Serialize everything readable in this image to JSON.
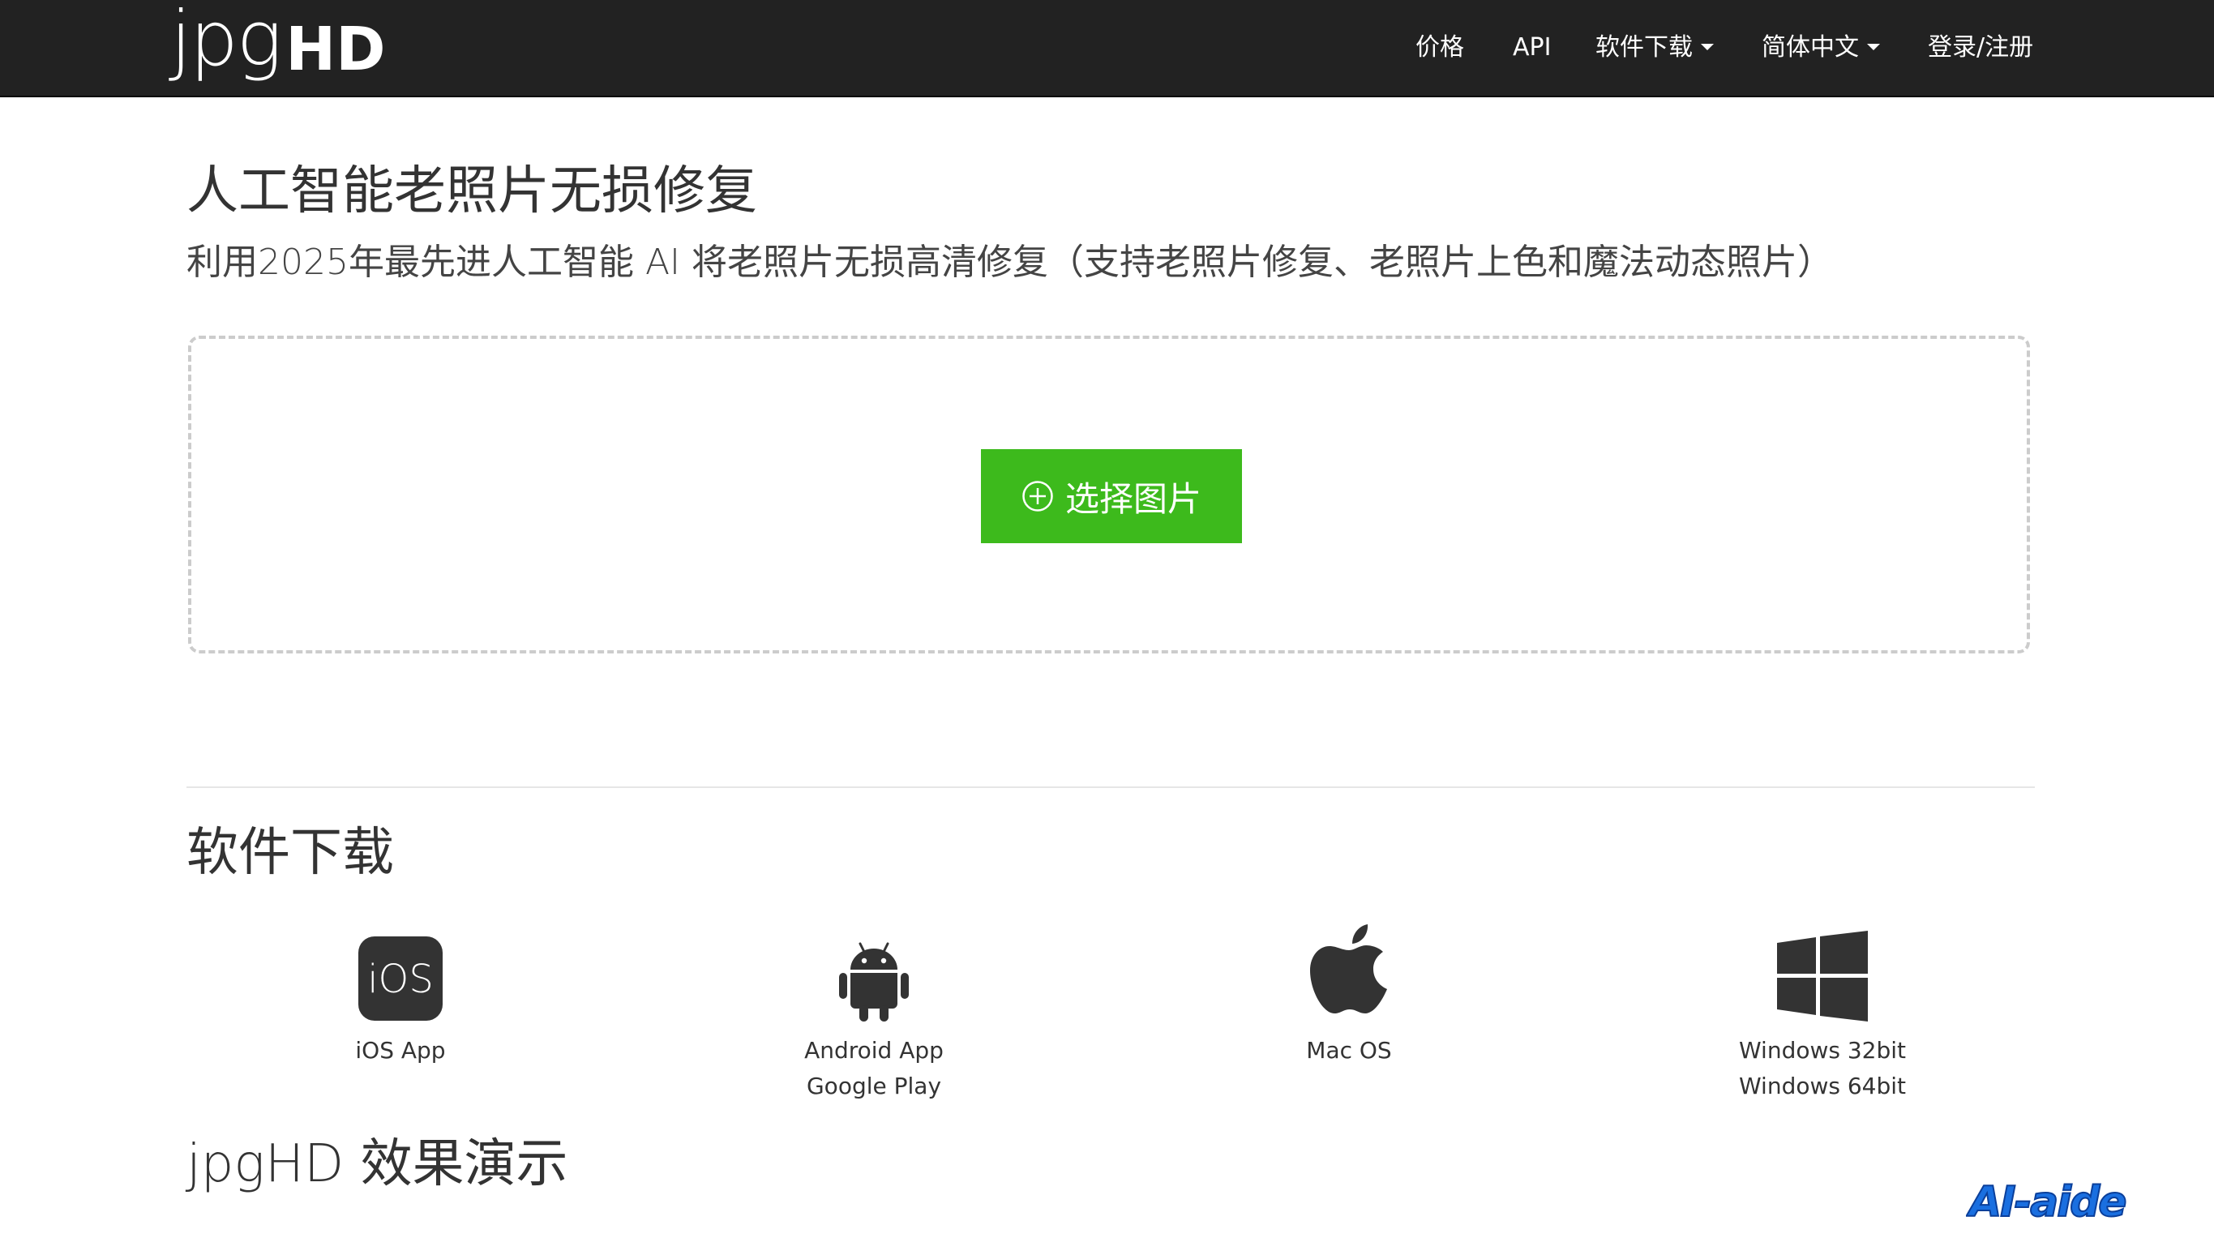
{
  "navbar": {
    "logo_light": "jpg",
    "logo_bold": "HD",
    "items": [
      {
        "label": "价格"
      },
      {
        "label": "API"
      },
      {
        "label": "软件下载"
      },
      {
        "label": "简体中文"
      },
      {
        "label": "登录/注册"
      }
    ]
  },
  "hero": {
    "title": "人工智能老照片无损修复",
    "subtitle": "利用2025年最先进人工智能 AI 将老照片无损高清修复（支持老照片修复、老照片上色和魔法动态照片）",
    "upload_button": "选择图片"
  },
  "downloads": {
    "title": "软件下载",
    "items": [
      {
        "icon": "ios-app-icon",
        "badge": "iOS",
        "lines": [
          "iOS App"
        ]
      },
      {
        "icon": "android-icon",
        "lines": [
          "Android App",
          "Google Play"
        ]
      },
      {
        "icon": "apple-icon",
        "lines": [
          "Mac OS"
        ]
      },
      {
        "icon": "windows-icon",
        "lines": [
          "Windows 32bit",
          "Windows 64bit"
        ]
      }
    ]
  },
  "demo": {
    "title": "jpgHD 效果演示"
  },
  "watermark": {
    "text": "AI-aide"
  },
  "colors": {
    "navbar_bg": "#222222",
    "upload_button_bg": "#3dba1c",
    "dropzone_border": "#cccccc",
    "watermark_blue": "#1a6fe0"
  }
}
